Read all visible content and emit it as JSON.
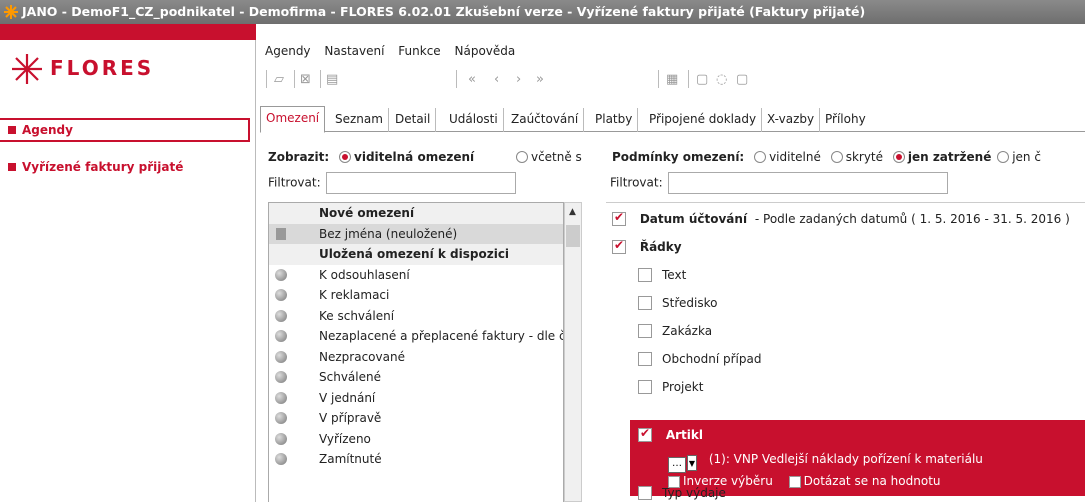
{
  "window": {
    "title": "JANO - DemoF1_CZ_podnikatel - Demofirma - FLORES 6.02.01 Zkušební verze - Vyřízené faktury přijaté  (Faktury přijaté)"
  },
  "logo": {
    "text": "FLORES"
  },
  "sidebar": {
    "agendy": "Agendy",
    "current": "Vyřízené faktury přijaté"
  },
  "menu": [
    "Agendy",
    "Nastavení",
    "Funkce",
    "Nápověda"
  ],
  "tabs": [
    "Omezení",
    "Seznam",
    "Detail",
    "Události",
    "Zaúčtování",
    "Platby",
    "Připojené doklady",
    "X-vazby",
    "Přílohy"
  ],
  "left_panel": {
    "zobrazit_label": "Zobrazit:",
    "opt1": "viditelná omezení",
    "opt2": "včetně s",
    "filtrovat": "Filtrovat:",
    "list": [
      {
        "text": "Nové omezení",
        "type": "head"
      },
      {
        "text": "Bez jména (neuložené)",
        "type": "sel"
      },
      {
        "text": "Uložená omezení k dispozici",
        "type": "head"
      },
      {
        "text": "K odsouhlasení",
        "type": "item"
      },
      {
        "text": "K reklamaci",
        "type": "item"
      },
      {
        "text": "Ke schválení",
        "type": "item"
      },
      {
        "text": "Nezaplacené a přeplacené faktury - dle č",
        "type": "item"
      },
      {
        "text": "Nezpracované",
        "type": "item"
      },
      {
        "text": "Schválené",
        "type": "item"
      },
      {
        "text": "V jednání",
        "type": "item"
      },
      {
        "text": "V přípravě",
        "type": "item"
      },
      {
        "text": "Vyřízeno",
        "type": "item"
      },
      {
        "text": "Zamítnuté",
        "type": "item"
      }
    ]
  },
  "right_panel": {
    "podminky_label": "Podmínky omezení:",
    "opt1": "viditelné",
    "opt2": "skryté",
    "opt3": "jen zatržené",
    "opt4": "jen č",
    "filtrovat": "Filtrovat:",
    "datum_label": "Datum účtování",
    "datum_desc": "- Podle zadaných datumů ( 1. 5. 2016 - 31. 5. 2016 )",
    "radky": "Řádky",
    "items": [
      "Text",
      "Středisko",
      "Zakázka",
      "Obchodní případ",
      "Projekt"
    ],
    "artikl": {
      "label": "Artikl",
      "value": "(1): VNP Vedlejší náklady pořízení k materiálu",
      "inverze": "Inverze výběru",
      "dotazat": "Dotázat se na hodnotu"
    },
    "typ_vydaje": "Typ výdaje"
  }
}
